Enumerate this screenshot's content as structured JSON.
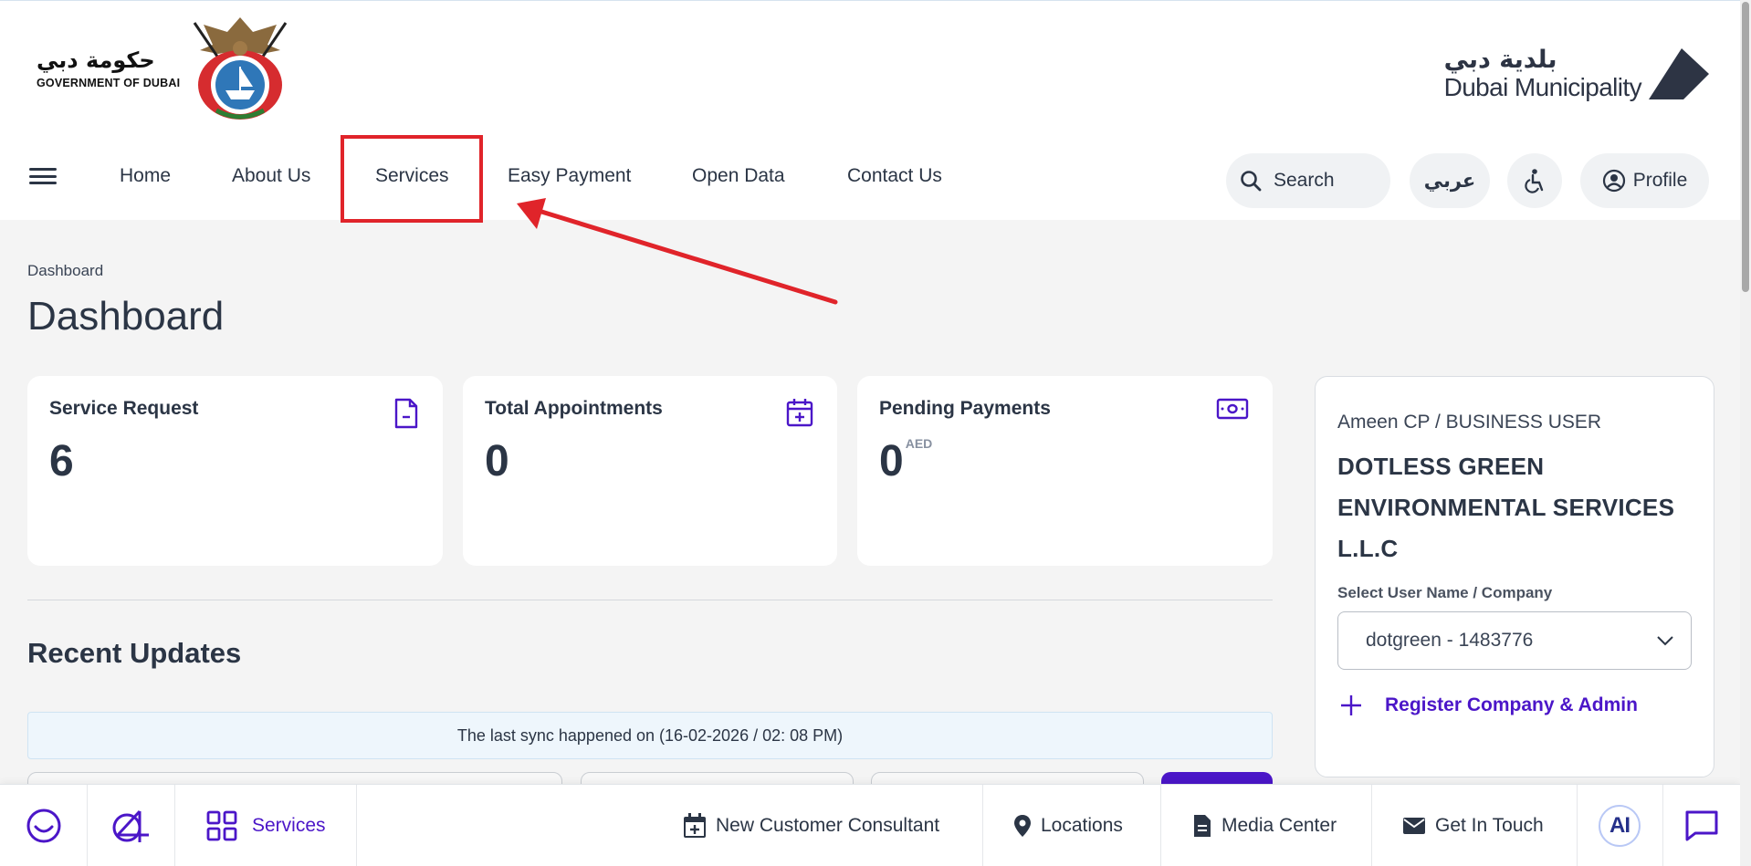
{
  "header": {
    "gov_logo_ar": "حكومة دبي",
    "gov_logo_en": "GOVERNMENT OF DUBAI",
    "dm_logo_ar": "بلدية دبي",
    "dm_logo_en": "Dubai Municipality"
  },
  "nav": {
    "items": [
      "Home",
      "About Us",
      "Services",
      "Easy Payment",
      "Open Data",
      "Contact Us"
    ],
    "search_label": "Search",
    "language_label": "عربي",
    "profile_label": "Profile"
  },
  "breadcrumb": "Dashboard",
  "page_title": "Dashboard",
  "cards": [
    {
      "title": "Service Request",
      "value": "6",
      "icon": "document-icon"
    },
    {
      "title": "Total Appointments",
      "value": "0",
      "icon": "calendar-plus-icon"
    },
    {
      "title": "Pending Payments",
      "value": "0",
      "unit": "AED",
      "icon": "money-icon"
    }
  ],
  "recent": {
    "title": "Recent Updates",
    "sync_text": "The last sync happened on (16-02-2026 / 02: 08 PM)"
  },
  "profile_panel": {
    "role": "Ameen CP / BUSINESS USER",
    "company_lines": [
      "DOTLESS GREEN",
      "ENVIRONMENTAL SERVICES",
      "L.L.C"
    ],
    "select_label": "Select User Name / Company",
    "selected_value": "dotgreen - 1483776",
    "register_label": "Register Company & Admin"
  },
  "bottom_bar": {
    "services_label": "Services",
    "new_customer_label": "New Customer Consultant",
    "locations_label": "Locations",
    "media_center_label": "Media Center",
    "get_in_touch_label": "Get In Touch",
    "ai_label": "AI"
  },
  "colors": {
    "accent_purple": "#4b16c8",
    "highlight_red": "#e0242a",
    "text_dark": "#2b3545"
  }
}
